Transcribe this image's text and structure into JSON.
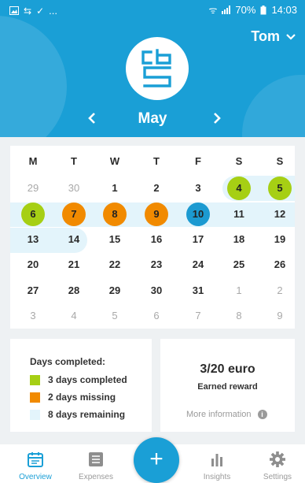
{
  "status_bar": {
    "battery": "70%",
    "time": "14:03",
    "notif_text": "..."
  },
  "header": {
    "user_name": "Tom",
    "month": "May",
    "colors": {
      "primary": "#1a9fd6"
    }
  },
  "calendar": {
    "weekdays": [
      "M",
      "T",
      "W",
      "T",
      "F",
      "S",
      "S"
    ],
    "weeks": [
      [
        "29",
        "30",
        "1",
        "2",
        "3",
        "4",
        "5"
      ],
      [
        "6",
        "7",
        "8",
        "9",
        "10",
        "11",
        "12"
      ],
      [
        "13",
        "14",
        "15",
        "16",
        "17",
        "18",
        "19"
      ],
      [
        "20",
        "21",
        "22",
        "23",
        "24",
        "25",
        "26"
      ],
      [
        "27",
        "28",
        "29",
        "30",
        "31",
        "1",
        "2"
      ],
      [
        "3",
        "4",
        "5",
        "6",
        "7",
        "8",
        "9"
      ]
    ],
    "status_colors": {
      "completed": "#a6cf14",
      "missing": "#f18a00",
      "today": "#1c9ad1",
      "remaining": "#e3f4fb"
    }
  },
  "legend": {
    "title": "Days completed:",
    "completed": "3 days completed",
    "missing": "2 days missing",
    "remaining": "8 days remaining"
  },
  "reward": {
    "amount": "3/20 euro",
    "label": "Earned reward",
    "more": "More information",
    "info_icon": "i"
  },
  "nav": {
    "overview": "Overview",
    "expenses": "Expenses",
    "add": "+",
    "insights": "Insights",
    "settings": "Settings"
  }
}
